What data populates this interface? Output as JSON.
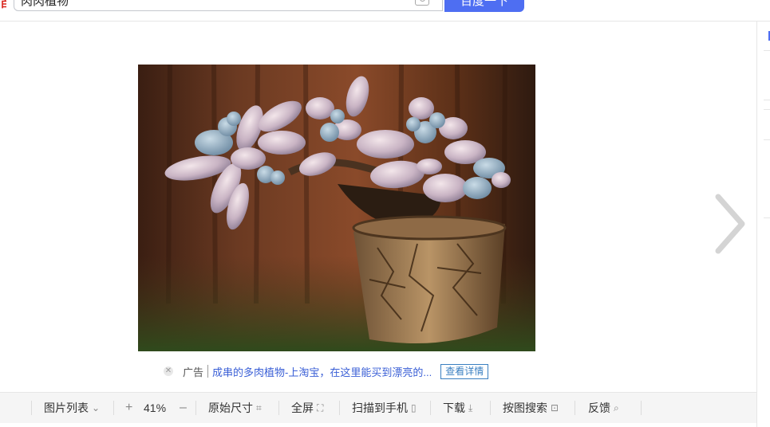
{
  "search": {
    "query": "肉肉植物",
    "button_label": "百度一下"
  },
  "ad": {
    "tag": "广告",
    "link_text": "成串的多肉植物-上淘宝，在这里能买到漂亮的...",
    "detail_button": "查看详情"
  },
  "toolbar": {
    "image_list": "图片列表",
    "zoom_in": "+",
    "zoom_level": "41%",
    "zoom_out": "–",
    "original_size": "原始尺寸",
    "fullscreen": "全屏",
    "scan_to_phone": "扫描到手机",
    "download": "下载",
    "image_search": "按图搜索",
    "feedback": "反馈"
  },
  "icons": {
    "camera": "camera-icon",
    "next": "chevron-right-icon",
    "close": "close-icon"
  },
  "colors": {
    "accent": "#4e6ef2",
    "ad_link": "#3a5fd6",
    "brand_red": "#d9251d"
  }
}
